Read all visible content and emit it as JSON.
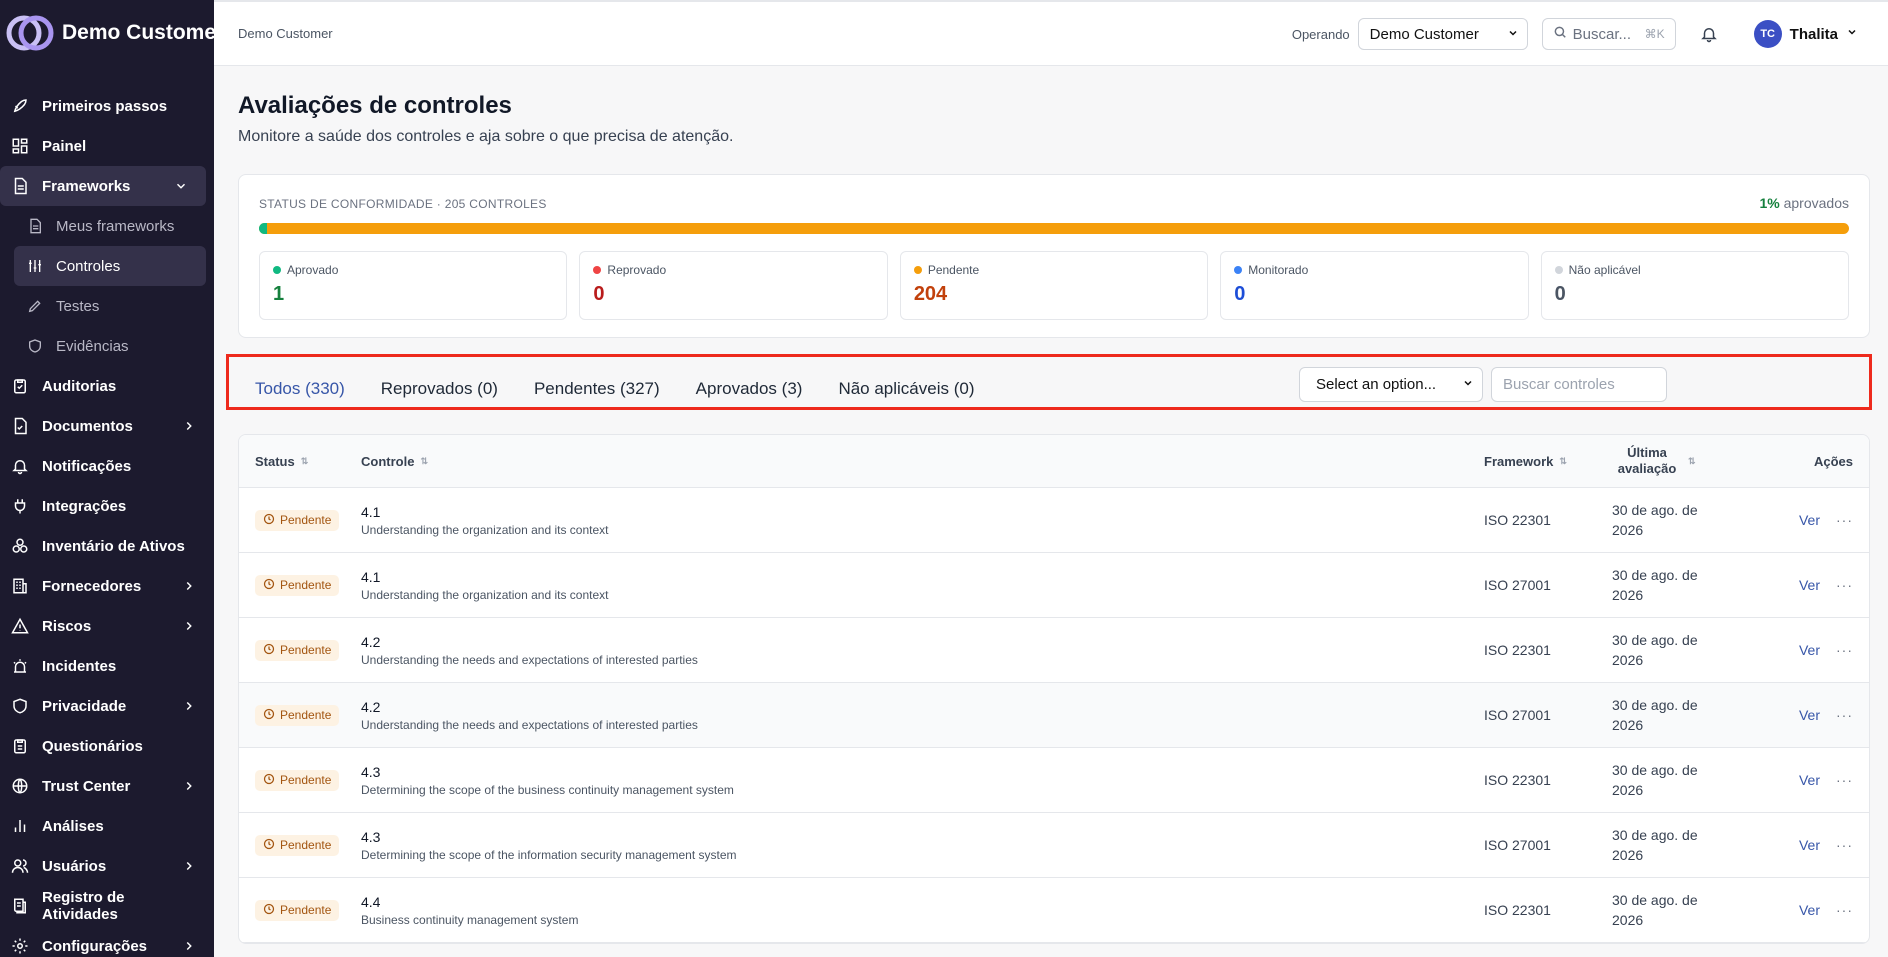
{
  "brand": {
    "name": "Demo Customer"
  },
  "sidebar": {
    "items": [
      {
        "label": "Primeiros passos",
        "icon": "rocket-icon"
      },
      {
        "label": "Painel",
        "icon": "grid-icon"
      },
      {
        "label": "Frameworks",
        "icon": "document-icon",
        "expanded": true
      },
      {
        "label": "Auditorias",
        "icon": "clipboard-icon"
      },
      {
        "label": "Documentos",
        "icon": "file-check-icon"
      },
      {
        "label": "Notificações",
        "icon": "bell-icon"
      },
      {
        "label": "Integrações",
        "icon": "plug-icon"
      },
      {
        "label": "Inventário de Ativos",
        "icon": "boxes-icon"
      },
      {
        "label": "Fornecedores",
        "icon": "building-icon"
      },
      {
        "label": "Riscos",
        "icon": "warning-icon"
      },
      {
        "label": "Incidentes",
        "icon": "siren-icon"
      },
      {
        "label": "Privacidade",
        "icon": "shield-icon"
      },
      {
        "label": "Questionários",
        "icon": "clipboard-list-icon"
      },
      {
        "label": "Trust Center",
        "icon": "globe-icon"
      },
      {
        "label": "Análises",
        "icon": "bar-chart-icon"
      },
      {
        "label": "Usuários",
        "icon": "users-icon"
      },
      {
        "label": "Registro de Atividades",
        "icon": "log-icon"
      },
      {
        "label": "Configurações",
        "icon": "gear-icon"
      }
    ],
    "sub_items": [
      {
        "label": "Meus frameworks",
        "icon": "document-icon"
      },
      {
        "label": "Controles",
        "icon": "sliders-icon"
      },
      {
        "label": "Testes",
        "icon": "pencil-icon"
      },
      {
        "label": "Evidências",
        "icon": "shield-icon"
      }
    ]
  },
  "topbar": {
    "breadcrumb": "Demo Customer",
    "operating_label": "Operando",
    "operating_value": "Demo Customer",
    "search_placeholder": "Buscar...",
    "search_shortcut": "⌘K",
    "user_initials": "TC",
    "user_name": "Thalita"
  },
  "page": {
    "title": "Avaliações de controles",
    "subtitle": "Monitore a saúde dos controles e aja sobre o que precisa de atenção."
  },
  "status": {
    "heading": "STATUS DE CONFORMIDADE · 205 CONTROLES",
    "pct_value": "1%",
    "pct_label": "aprovados",
    "approved_fraction": 0.005,
    "tiles": [
      {
        "label": "Aprovado",
        "value": "1",
        "color": "#10b981",
        "value_color": "#15803d"
      },
      {
        "label": "Reprovado",
        "value": "0",
        "color": "#ef4444",
        "value_color": "#b91c1c"
      },
      {
        "label": "Pendente",
        "value": "204",
        "color": "#f59e0b",
        "value_color": "#c2410c"
      },
      {
        "label": "Monitorado",
        "value": "0",
        "color": "#3b82f6",
        "value_color": "#1d4ed8"
      },
      {
        "label": "Não aplicável",
        "value": "0",
        "color": "#d1d5db",
        "value_color": "#4b5563"
      }
    ]
  },
  "tabs": [
    {
      "label": "Todos (330)",
      "active": true
    },
    {
      "label": "Reprovados (0)"
    },
    {
      "label": "Pendentes (327)"
    },
    {
      "label": "Aprovados (3)"
    },
    {
      "label": "Não aplicáveis (0)"
    }
  ],
  "filters": {
    "select_value": "Select an option...",
    "search_placeholder": "Buscar controles"
  },
  "table": {
    "headers": {
      "status": "Status",
      "control": "Controle",
      "framework": "Framework",
      "last_eval": "Última avaliação",
      "actions": "Ações"
    },
    "rows": [
      {
        "status": "Pendente",
        "id": "4.1",
        "desc": "Understanding the organization and its context",
        "framework": "ISO 22301",
        "date_line1": "30 de ago. de",
        "date_line2": "2026",
        "action": "Ver"
      },
      {
        "status": "Pendente",
        "id": "4.1",
        "desc": "Understanding the organization and its context",
        "framework": "ISO 27001",
        "date_line1": "30 de ago. de",
        "date_line2": "2026",
        "action": "Ver"
      },
      {
        "status": "Pendente",
        "id": "4.2",
        "desc": "Understanding the needs and expectations of interested parties",
        "framework": "ISO 22301",
        "date_line1": "30 de ago. de",
        "date_line2": "2026",
        "action": "Ver"
      },
      {
        "status": "Pendente",
        "id": "4.2",
        "desc": "Understanding the needs and expectations of interested parties",
        "framework": "ISO 27001",
        "date_line1": "30 de ago. de",
        "date_line2": "2026",
        "action": "Ver"
      },
      {
        "status": "Pendente",
        "id": "4.3",
        "desc": "Determining the scope of the business continuity management system",
        "framework": "ISO 22301",
        "date_line1": "30 de ago. de",
        "date_line2": "2026",
        "action": "Ver"
      },
      {
        "status": "Pendente",
        "id": "4.3",
        "desc": "Determining the scope of the information security management system",
        "framework": "ISO 27001",
        "date_line1": "30 de ago. de",
        "date_line2": "2026",
        "action": "Ver"
      },
      {
        "status": "Pendente",
        "id": "4.4",
        "desc": "Business continuity management system",
        "framework": "ISO 22301",
        "date_line1": "30 de ago. de",
        "date_line2": "2026",
        "action": "Ver"
      }
    ]
  }
}
